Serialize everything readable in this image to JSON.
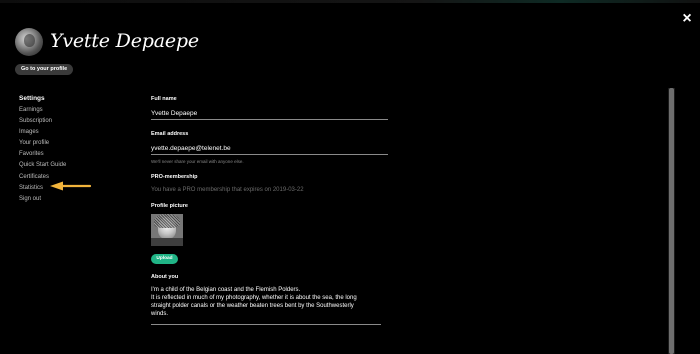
{
  "header": {
    "user_name": "Yvette Depaepe",
    "profile_button": "Go to your profile",
    "close_glyph": "×"
  },
  "sidebar": {
    "heading": "Settings",
    "items": [
      {
        "label": "Earnings"
      },
      {
        "label": "Subscription"
      },
      {
        "label": "Images"
      },
      {
        "label": "Your profile"
      },
      {
        "label": "Favorites"
      },
      {
        "label": "Quick Start Guide"
      },
      {
        "label": "Certificates"
      },
      {
        "label": "Statistics"
      },
      {
        "label": "Sign out"
      }
    ]
  },
  "form": {
    "full_name": {
      "label": "Full name",
      "value": "Yvette Depaepe"
    },
    "email": {
      "label": "Email address",
      "value": "yvette.depaepe@telenet.be",
      "hint": "We'll never share your email with anyone else."
    },
    "membership": {
      "label": "PRO-membership",
      "text": "You have a PRO membership that expires on 2019-03-22"
    },
    "profile_picture": {
      "label": "Profile picture",
      "upload_label": "Upload"
    },
    "about": {
      "label": "About you",
      "lines": [
        "I'm a child of the Belgian coast and the Flemish Polders.",
        "It is reflected in much of my photography, whether it is about the sea, the long",
        "straight polder canals or the weather beaten trees bent by the Southwesterly",
        "winds."
      ]
    }
  },
  "colors": {
    "background": "#000000",
    "accent_button": "#20b486",
    "annotation_arrow": "#f2b43c"
  }
}
